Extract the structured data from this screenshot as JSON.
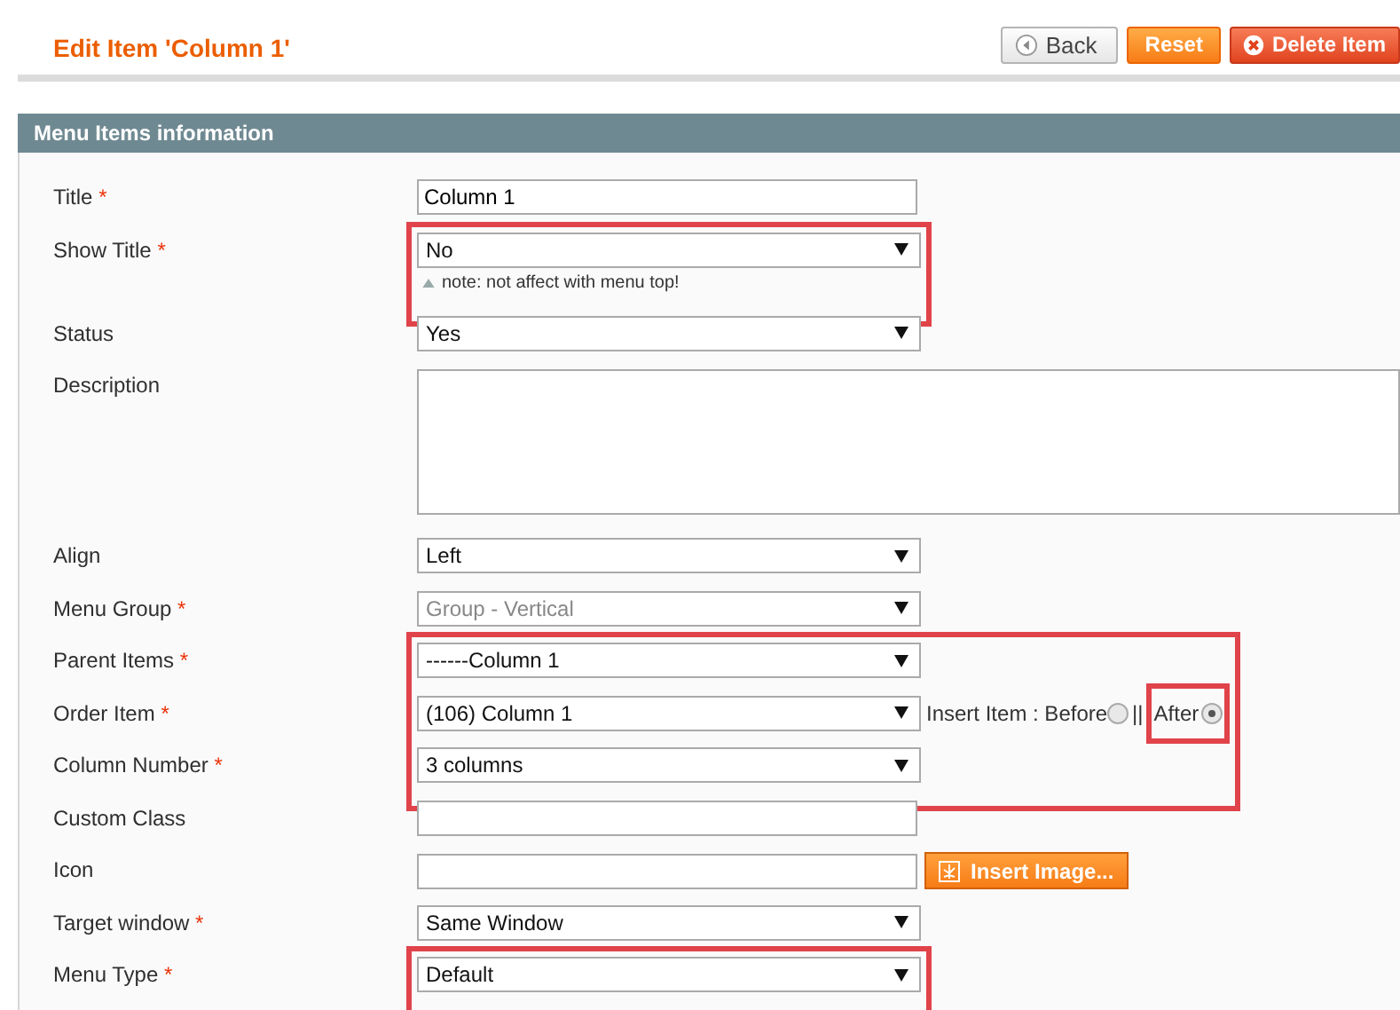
{
  "page_title": "Edit Item 'Column 1'",
  "actions": [
    {
      "kind": "back",
      "label": "Back"
    },
    {
      "kind": "reset",
      "label": "Reset"
    },
    {
      "kind": "delete",
      "label": "Delete Item"
    }
  ],
  "section": {
    "title": "Menu Items information",
    "blocks": [
      {
        "highlighted": false,
        "fields": [
          {
            "label": "Title",
            "mark": "*",
            "kind": "text",
            "value": "Column 1"
          }
        ]
      },
      {
        "highlighted": true,
        "fields": [
          {
            "label": "Show Title",
            "mark": "*",
            "kind": "select",
            "value": "No",
            "note": "note: not affect with menu top!"
          }
        ]
      },
      {
        "highlighted": false,
        "fields": [
          {
            "label": "Status",
            "kind": "select",
            "value": "Yes"
          },
          {
            "label": "Description",
            "kind": "textarea"
          },
          {
            "label": "Align",
            "kind": "select",
            "value": "Left"
          },
          {
            "label": "Menu Group",
            "mark": "*",
            "kind": "select",
            "value": "Group - Vertical",
            "disabled": true
          }
        ]
      },
      {
        "highlighted": true,
        "fields": [
          {
            "label": "Parent Items",
            "mark": "*",
            "kind": "select",
            "value": "------Column 1"
          },
          {
            "label": "Order Item",
            "mark": "*",
            "kind": "select",
            "value": "(106) Column 1",
            "insert": {
              "label": "Insert Item : Before",
              "separator": "||",
              "after": "After",
              "before_selected": false,
              "after_selected": true,
              "after_highlighted": true
            }
          },
          {
            "label": "Column Number",
            "mark": "*",
            "kind": "select",
            "value": "3 columns"
          }
        ]
      },
      {
        "highlighted": false,
        "fields": [
          {
            "label": "Custom Class",
            "kind": "text"
          },
          {
            "label": "Icon",
            "kind": "image",
            "button": "Insert Image..."
          },
          {
            "label": "Target window",
            "mark": "*",
            "kind": "select",
            "value": "Same Window"
          }
        ]
      },
      {
        "highlighted": true,
        "fields": [
          {
            "label": "Menu Type",
            "mark": "*",
            "kind": "select",
            "value": "Default"
          }
        ]
      }
    ]
  }
}
